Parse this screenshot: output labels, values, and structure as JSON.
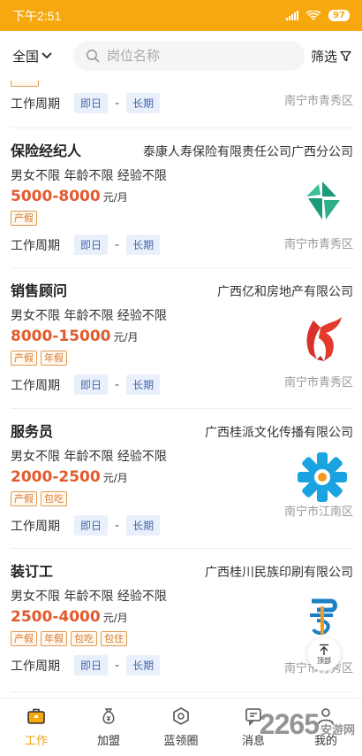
{
  "status_bar": {
    "time": "下午2:51",
    "battery": "97"
  },
  "search": {
    "region": "全国",
    "placeholder": "岗位名称",
    "filter_label": "筛选"
  },
  "partial_card": {
    "period_label": "工作周期",
    "period_start": "即日",
    "period_end": "长期",
    "location": "南宁市青秀区"
  },
  "jobs": [
    {
      "title": "保险经纪人",
      "company": "泰康人寿保险有限责任公司广西分公司",
      "requirements": "男女不限 年龄不限  经验不限",
      "salary": "5000-8000",
      "unit": "元/月",
      "tags": [
        "产假"
      ],
      "period_label": "工作周期",
      "period_start": "即日",
      "period_end": "长期",
      "location": "南宁市青秀区"
    },
    {
      "title": "销售顾问",
      "company": "广西亿和房地产有限公司",
      "requirements": "男女不限 年龄不限  经验不限",
      "salary": "8000-15000",
      "unit": "元/月",
      "tags": [
        "产假",
        "年假"
      ],
      "period_label": "工作周期",
      "period_start": "即日",
      "period_end": "长期",
      "location": "南宁市青秀区"
    },
    {
      "title": "服务员",
      "company": "广西桂派文化传播有限公司",
      "requirements": "男女不限 年龄不限  经验不限",
      "salary": "2000-2500",
      "unit": "元/月",
      "tags": [
        "产假",
        "包吃"
      ],
      "period_label": "工作周期",
      "period_start": "即日",
      "period_end": "长期",
      "location": "南宁市江南区"
    },
    {
      "title": "装订工",
      "company": "广西桂川民族印刷有限公司",
      "requirements": "男女不限 年龄不限  经验不限",
      "salary": "2500-4000",
      "unit": "元/月",
      "tags": [
        "产假",
        "年假",
        "包吃",
        "包住"
      ],
      "period_label": "工作周期",
      "period_start": "即日",
      "period_end": "长期",
      "location": "南宁市青秀区"
    }
  ],
  "back_top_label": "顶部",
  "tabs": [
    {
      "label": "工作",
      "icon": "briefcase-icon",
      "active": true
    },
    {
      "label": "加盟",
      "icon": "money-bag-icon",
      "active": false
    },
    {
      "label": "蓝领圈",
      "icon": "hexagon-icon",
      "active": false
    },
    {
      "label": "消息",
      "icon": "message-icon",
      "active": false
    },
    {
      "label": "我的",
      "icon": "user-icon",
      "active": false
    }
  ],
  "watermark": {
    "number": "2265",
    "suffix": "安游网"
  },
  "colors": {
    "accent": "#f7a80f",
    "salary": "#e25a2c",
    "tag_border": "#e29b55",
    "pill_bg": "#eaf0fb"
  }
}
